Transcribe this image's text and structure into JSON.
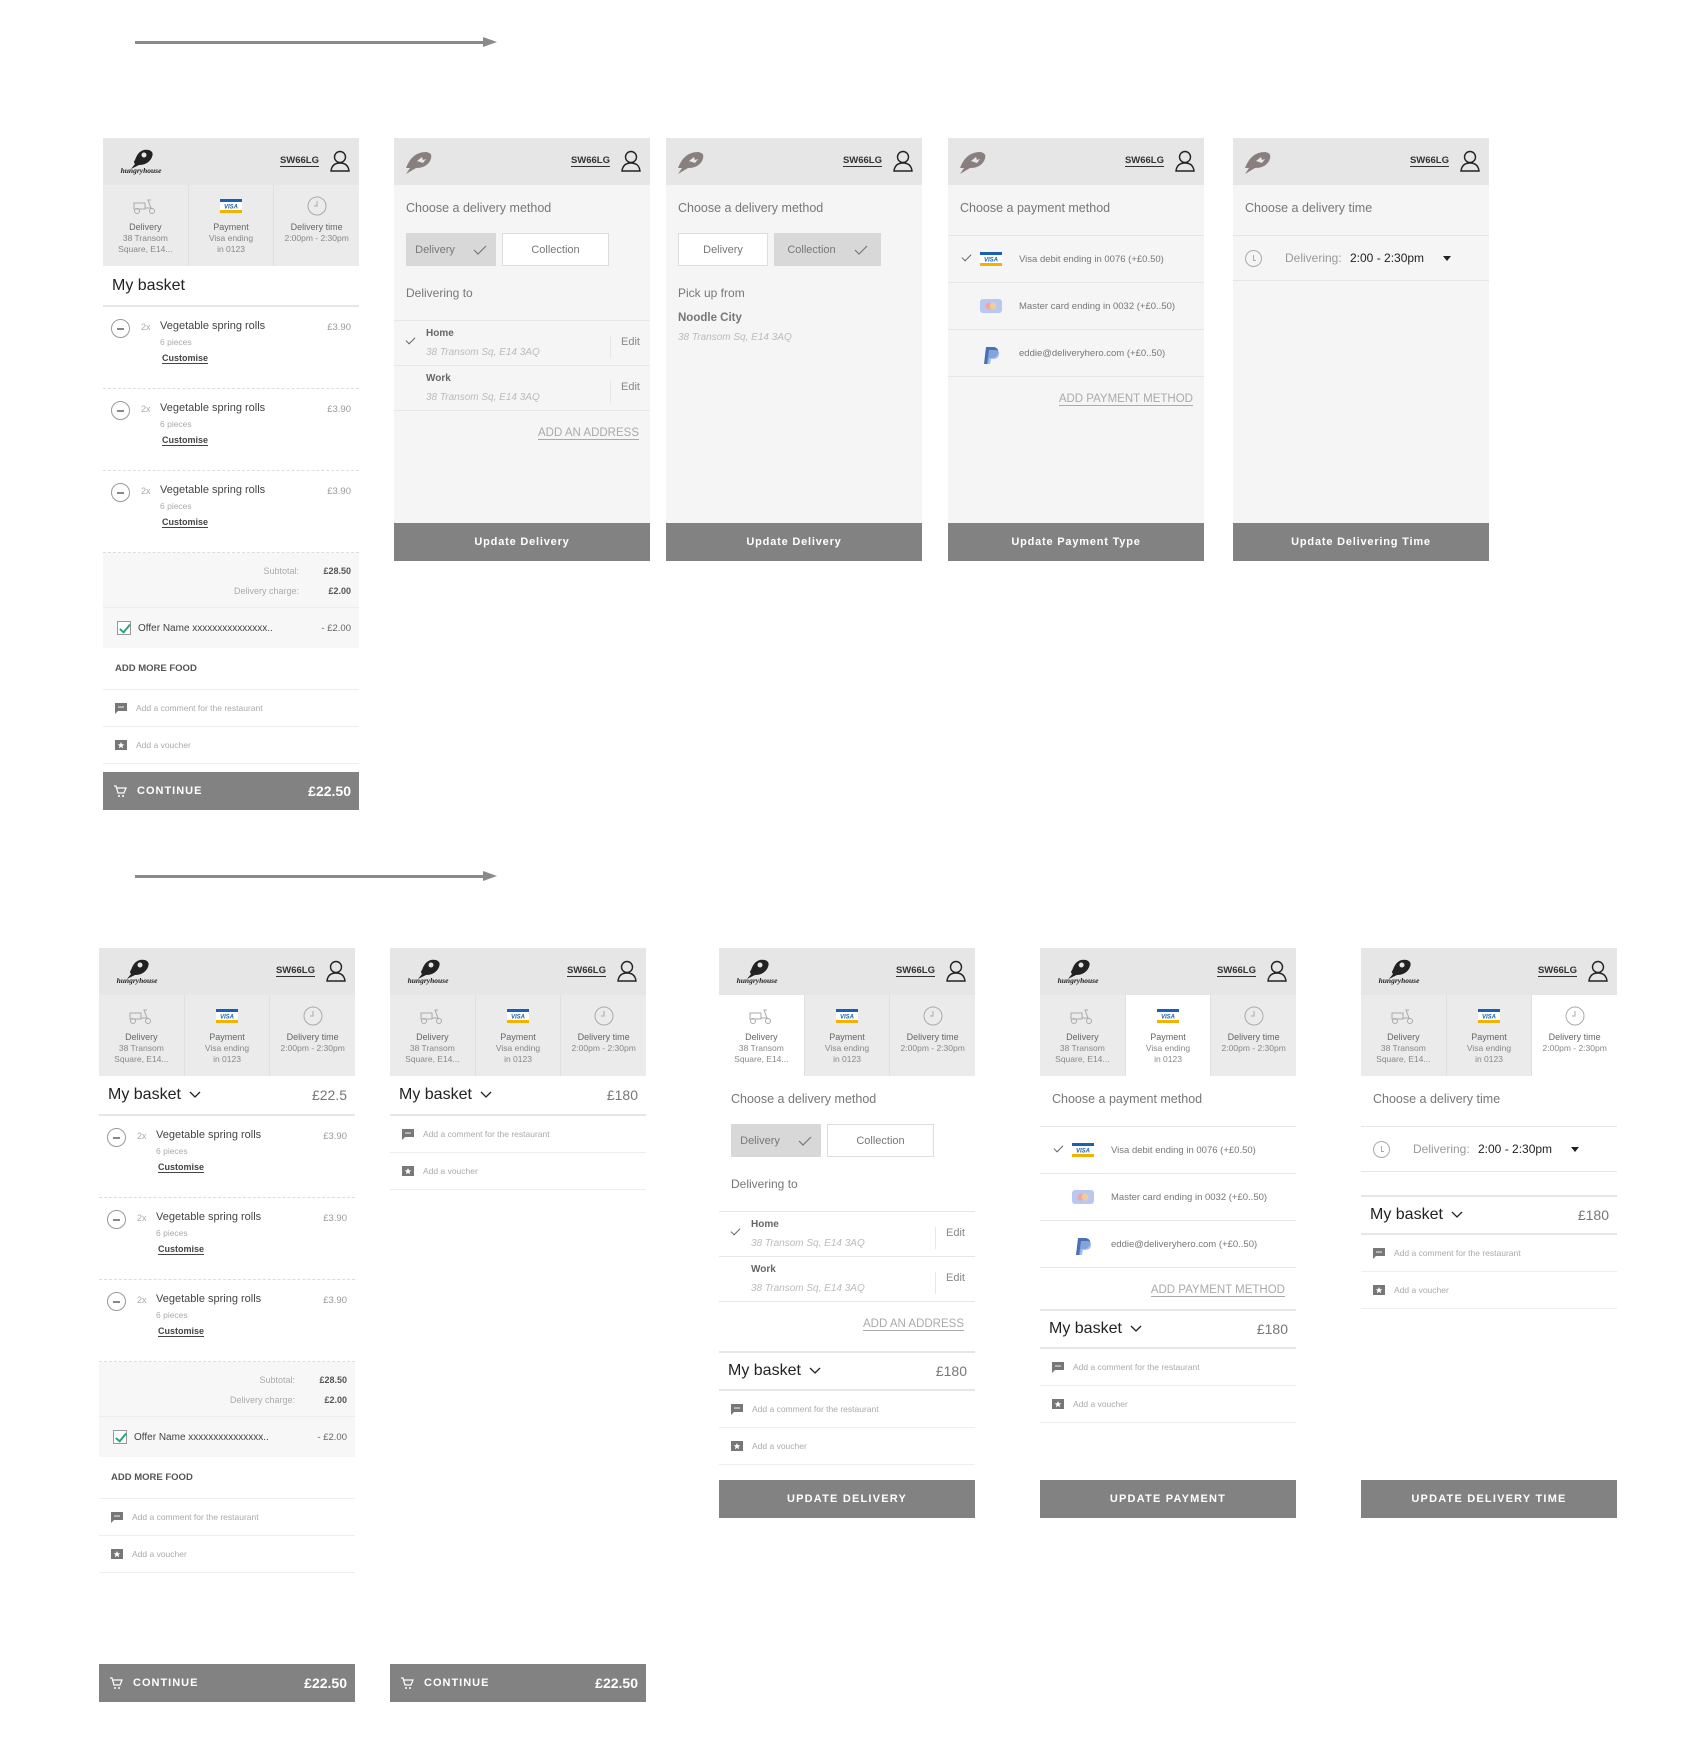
{
  "header": {
    "postcode": "SW66LG",
    "brand": "hungryhouse"
  },
  "summary_tabs": [
    {
      "id": "delivery",
      "icon": "scooter-icon",
      "title": "Delivery",
      "lines": [
        "38 Transom",
        "Square, E14..."
      ]
    },
    {
      "id": "payment",
      "icon": "visa-card-icon",
      "title": "Payment",
      "lines": [
        "Visa ending",
        "in 0123"
      ]
    },
    {
      "id": "time",
      "icon": "clock-icon",
      "title": "Delivery time",
      "lines": [
        "2:00pm - 2:30pm"
      ]
    }
  ],
  "basket": {
    "title": "My basket",
    "items": [
      {
        "qty": "2x",
        "name": "Vegetable spring rolls",
        "desc": "6 pieces",
        "price": "£3.90",
        "customise": "Customise"
      },
      {
        "qty": "2x",
        "name": "Vegetable spring rolls",
        "desc": "6 pieces",
        "price": "£3.90",
        "customise": "Customise"
      },
      {
        "qty": "2x",
        "name": "Vegetable spring rolls",
        "desc": "6 pieces",
        "price": "£3.90",
        "customise": "Customise"
      }
    ],
    "subtotal_label": "Subtotal:",
    "subtotal": "£28.50",
    "delivery_label": "Delivery charge:",
    "delivery": "£2.00",
    "offer_name": "Offer Name xxxxxxxxxxxxxxx..",
    "offer_value": "- £2.00",
    "offer_checked": true,
    "add_more": "ADD MORE FOOD",
    "comment": "Add a comment for the restaurant",
    "voucher": "Add a voucher",
    "total_collapsed_a": "£22.5",
    "total_collapsed_b": "£180"
  },
  "continue": {
    "label": "CONTINUE",
    "price": "£22.50"
  },
  "delivery_method": {
    "title": "Choose a delivery method",
    "options": [
      "Delivery",
      "Collection"
    ],
    "delivering_to": "Delivering to",
    "addresses": [
      {
        "name": "Home",
        "address": "38 Transom Sq, E14 3AQ",
        "selected": true,
        "edit": "Edit"
      },
      {
        "name": "Work",
        "address": "38 Transom Sq, E14 3AQ",
        "selected": false,
        "edit": "Edit"
      }
    ],
    "add_address": "ADD AN ADDRESS",
    "pick_up_from": "Pick up from",
    "restaurant": "Noodle City",
    "restaurant_address": "38 Transom Sq, E14 3AQ"
  },
  "payment_method": {
    "title": "Choose a payment method",
    "options": [
      {
        "icon": "visa-card-icon",
        "label": "Visa debit ending in 0076 (+£0.50)",
        "selected": true
      },
      {
        "icon": "mastercard-icon",
        "label": "Master card ending in 0032 (+£0..50)",
        "selected": false
      },
      {
        "icon": "paypal-icon",
        "label": "eddie@deliveryhero.com (+£0..50)",
        "selected": false
      }
    ],
    "add": "ADD PAYMENT METHOD"
  },
  "delivery_time": {
    "title": "Choose a delivery time",
    "label": "Delivering:",
    "value": "2:00 - 2:30pm"
  },
  "buttons": {
    "update_delivery": "Update Delivery",
    "update_payment_type": "Update Payment Type",
    "update_delivering_time": "Update Delivering Time",
    "update_delivery_caps": "UPDATE DELIVERY",
    "update_payment_caps": "UPDATE PAYMENT",
    "update_delivery_time_caps": "UPDATE DELIVERY TIME"
  },
  "colors": {
    "header_bg": "#e6e6e6",
    "cta_bg": "#828282",
    "check_green": "#2aa57a",
    "visa_blue": "#1a5fb4",
    "visa_gold": "#f0b400"
  }
}
